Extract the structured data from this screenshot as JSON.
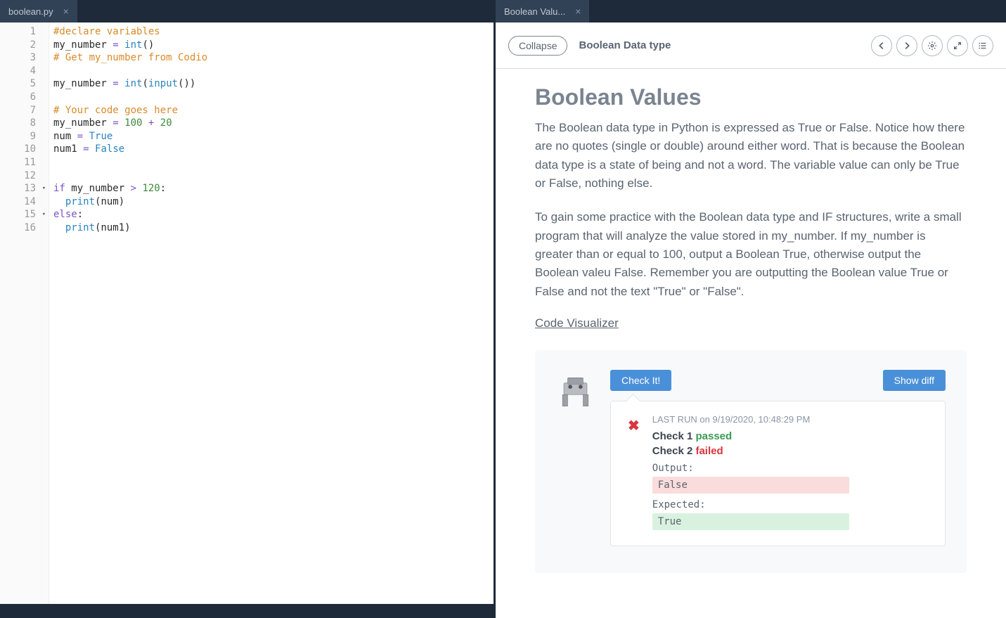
{
  "left": {
    "tab_name": "boolean.py",
    "code_lines": [
      {
        "n": 1,
        "tokens": [
          [
            "c-comment",
            "#declare variables"
          ]
        ]
      },
      {
        "n": 2,
        "tokens": [
          [
            "c-ident",
            "my_number "
          ],
          [
            "c-op",
            "="
          ],
          [
            "c-ident",
            " "
          ],
          [
            "c-func",
            "int"
          ],
          [
            "c-ident",
            "()"
          ]
        ]
      },
      {
        "n": 3,
        "tokens": [
          [
            "c-comment",
            "# Get my_number from Codio"
          ]
        ]
      },
      {
        "n": 4,
        "tokens": []
      },
      {
        "n": 5,
        "tokens": [
          [
            "c-ident",
            "my_number "
          ],
          [
            "c-op",
            "="
          ],
          [
            "c-ident",
            " "
          ],
          [
            "c-func",
            "int"
          ],
          [
            "c-ident",
            "("
          ],
          [
            "c-func",
            "input"
          ],
          [
            "c-ident",
            "())"
          ]
        ]
      },
      {
        "n": 6,
        "tokens": []
      },
      {
        "n": 7,
        "tokens": [
          [
            "c-comment",
            "# Your code goes here"
          ]
        ]
      },
      {
        "n": 8,
        "tokens": [
          [
            "c-ident",
            "my_number "
          ],
          [
            "c-op",
            "="
          ],
          [
            "c-ident",
            " "
          ],
          [
            "c-num",
            "100"
          ],
          [
            "c-ident",
            " "
          ],
          [
            "c-op",
            "+"
          ],
          [
            "c-ident",
            " "
          ],
          [
            "c-num",
            "20"
          ]
        ]
      },
      {
        "n": 9,
        "tokens": [
          [
            "c-ident",
            "num "
          ],
          [
            "c-op",
            "="
          ],
          [
            "c-ident",
            " "
          ],
          [
            "c-bool",
            "True"
          ]
        ]
      },
      {
        "n": 10,
        "tokens": [
          [
            "c-ident",
            "num1 "
          ],
          [
            "c-op",
            "="
          ],
          [
            "c-ident",
            " "
          ],
          [
            "c-bool",
            "False"
          ]
        ]
      },
      {
        "n": 11,
        "tokens": []
      },
      {
        "n": 12,
        "tokens": []
      },
      {
        "n": 13,
        "fold": true,
        "tokens": [
          [
            "c-kw",
            "if"
          ],
          [
            "c-ident",
            " my_number "
          ],
          [
            "c-op",
            ">"
          ],
          [
            "c-ident",
            " "
          ],
          [
            "c-num",
            "120"
          ],
          [
            "c-ident",
            ":"
          ]
        ]
      },
      {
        "n": 14,
        "tokens": [
          [
            "c-ident",
            "  "
          ],
          [
            "c-func",
            "print"
          ],
          [
            "c-ident",
            "(num)"
          ]
        ]
      },
      {
        "n": 15,
        "fold": true,
        "tokens": [
          [
            "c-kw",
            "else"
          ],
          [
            "c-ident",
            ":"
          ]
        ]
      },
      {
        "n": 16,
        "tokens": [
          [
            "c-ident",
            "  "
          ],
          [
            "c-func",
            "print"
          ],
          [
            "c-ident",
            "(num1)"
          ]
        ]
      }
    ]
  },
  "right": {
    "tab_name": "Boolean Valu...",
    "collapse": "Collapse",
    "header_title": "Boolean Data type",
    "h1": "Boolean Values",
    "p1": "The Boolean data type in Python is expressed as True or False. Notice how there are no quotes (single or double) around either word. That is because the Boolean data type is a state of being and not a word. The variable value can only be True or False, nothing else.",
    "p2": "To gain some practice with the Boolean data type and IF structures, write a small program that will analyze the value stored in my_number. If my_number is greater than or equal to 100, output a Boolean True, otherwise output the Boolean valeu False. Remember you are outputting the Boolean value True or False and not the text \"True\" or \"False\".",
    "link": "Code Visualizer",
    "check_it": "Check It!",
    "show_diff": "Show diff",
    "last_run": "LAST RUN on 9/19/2020, 10:48:29 PM",
    "check1_label": "Check 1 ",
    "check1_status": "passed",
    "check2_label": "Check 2 ",
    "check2_status": "failed",
    "output_label": "Output:",
    "output_value": "False",
    "expected_label": "Expected:",
    "expected_value": "True"
  }
}
